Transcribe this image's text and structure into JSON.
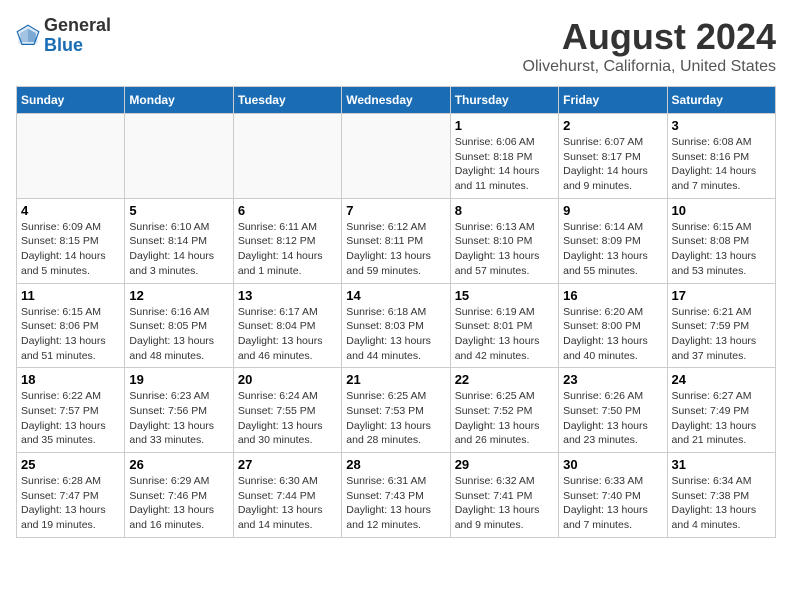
{
  "header": {
    "logo_general": "General",
    "logo_blue": "Blue",
    "main_title": "August 2024",
    "subtitle": "Olivehurst, California, United States"
  },
  "days_of_week": [
    "Sunday",
    "Monday",
    "Tuesday",
    "Wednesday",
    "Thursday",
    "Friday",
    "Saturday"
  ],
  "weeks": [
    [
      {
        "day": "",
        "info": ""
      },
      {
        "day": "",
        "info": ""
      },
      {
        "day": "",
        "info": ""
      },
      {
        "day": "",
        "info": ""
      },
      {
        "day": "1",
        "info": "Sunrise: 6:06 AM\nSunset: 8:18 PM\nDaylight: 14 hours\nand 11 minutes."
      },
      {
        "day": "2",
        "info": "Sunrise: 6:07 AM\nSunset: 8:17 PM\nDaylight: 14 hours\nand 9 minutes."
      },
      {
        "day": "3",
        "info": "Sunrise: 6:08 AM\nSunset: 8:16 PM\nDaylight: 14 hours\nand 7 minutes."
      }
    ],
    [
      {
        "day": "4",
        "info": "Sunrise: 6:09 AM\nSunset: 8:15 PM\nDaylight: 14 hours\nand 5 minutes."
      },
      {
        "day": "5",
        "info": "Sunrise: 6:10 AM\nSunset: 8:14 PM\nDaylight: 14 hours\nand 3 minutes."
      },
      {
        "day": "6",
        "info": "Sunrise: 6:11 AM\nSunset: 8:12 PM\nDaylight: 14 hours\nand 1 minute."
      },
      {
        "day": "7",
        "info": "Sunrise: 6:12 AM\nSunset: 8:11 PM\nDaylight: 13 hours\nand 59 minutes."
      },
      {
        "day": "8",
        "info": "Sunrise: 6:13 AM\nSunset: 8:10 PM\nDaylight: 13 hours\nand 57 minutes."
      },
      {
        "day": "9",
        "info": "Sunrise: 6:14 AM\nSunset: 8:09 PM\nDaylight: 13 hours\nand 55 minutes."
      },
      {
        "day": "10",
        "info": "Sunrise: 6:15 AM\nSunset: 8:08 PM\nDaylight: 13 hours\nand 53 minutes."
      }
    ],
    [
      {
        "day": "11",
        "info": "Sunrise: 6:15 AM\nSunset: 8:06 PM\nDaylight: 13 hours\nand 51 minutes."
      },
      {
        "day": "12",
        "info": "Sunrise: 6:16 AM\nSunset: 8:05 PM\nDaylight: 13 hours\nand 48 minutes."
      },
      {
        "day": "13",
        "info": "Sunrise: 6:17 AM\nSunset: 8:04 PM\nDaylight: 13 hours\nand 46 minutes."
      },
      {
        "day": "14",
        "info": "Sunrise: 6:18 AM\nSunset: 8:03 PM\nDaylight: 13 hours\nand 44 minutes."
      },
      {
        "day": "15",
        "info": "Sunrise: 6:19 AM\nSunset: 8:01 PM\nDaylight: 13 hours\nand 42 minutes."
      },
      {
        "day": "16",
        "info": "Sunrise: 6:20 AM\nSunset: 8:00 PM\nDaylight: 13 hours\nand 40 minutes."
      },
      {
        "day": "17",
        "info": "Sunrise: 6:21 AM\nSunset: 7:59 PM\nDaylight: 13 hours\nand 37 minutes."
      }
    ],
    [
      {
        "day": "18",
        "info": "Sunrise: 6:22 AM\nSunset: 7:57 PM\nDaylight: 13 hours\nand 35 minutes."
      },
      {
        "day": "19",
        "info": "Sunrise: 6:23 AM\nSunset: 7:56 PM\nDaylight: 13 hours\nand 33 minutes."
      },
      {
        "day": "20",
        "info": "Sunrise: 6:24 AM\nSunset: 7:55 PM\nDaylight: 13 hours\nand 30 minutes."
      },
      {
        "day": "21",
        "info": "Sunrise: 6:25 AM\nSunset: 7:53 PM\nDaylight: 13 hours\nand 28 minutes."
      },
      {
        "day": "22",
        "info": "Sunrise: 6:25 AM\nSunset: 7:52 PM\nDaylight: 13 hours\nand 26 minutes."
      },
      {
        "day": "23",
        "info": "Sunrise: 6:26 AM\nSunset: 7:50 PM\nDaylight: 13 hours\nand 23 minutes."
      },
      {
        "day": "24",
        "info": "Sunrise: 6:27 AM\nSunset: 7:49 PM\nDaylight: 13 hours\nand 21 minutes."
      }
    ],
    [
      {
        "day": "25",
        "info": "Sunrise: 6:28 AM\nSunset: 7:47 PM\nDaylight: 13 hours\nand 19 minutes."
      },
      {
        "day": "26",
        "info": "Sunrise: 6:29 AM\nSunset: 7:46 PM\nDaylight: 13 hours\nand 16 minutes."
      },
      {
        "day": "27",
        "info": "Sunrise: 6:30 AM\nSunset: 7:44 PM\nDaylight: 13 hours\nand 14 minutes."
      },
      {
        "day": "28",
        "info": "Sunrise: 6:31 AM\nSunset: 7:43 PM\nDaylight: 13 hours\nand 12 minutes."
      },
      {
        "day": "29",
        "info": "Sunrise: 6:32 AM\nSunset: 7:41 PM\nDaylight: 13 hours\nand 9 minutes."
      },
      {
        "day": "30",
        "info": "Sunrise: 6:33 AM\nSunset: 7:40 PM\nDaylight: 13 hours\nand 7 minutes."
      },
      {
        "day": "31",
        "info": "Sunrise: 6:34 AM\nSunset: 7:38 PM\nDaylight: 13 hours\nand 4 minutes."
      }
    ]
  ]
}
